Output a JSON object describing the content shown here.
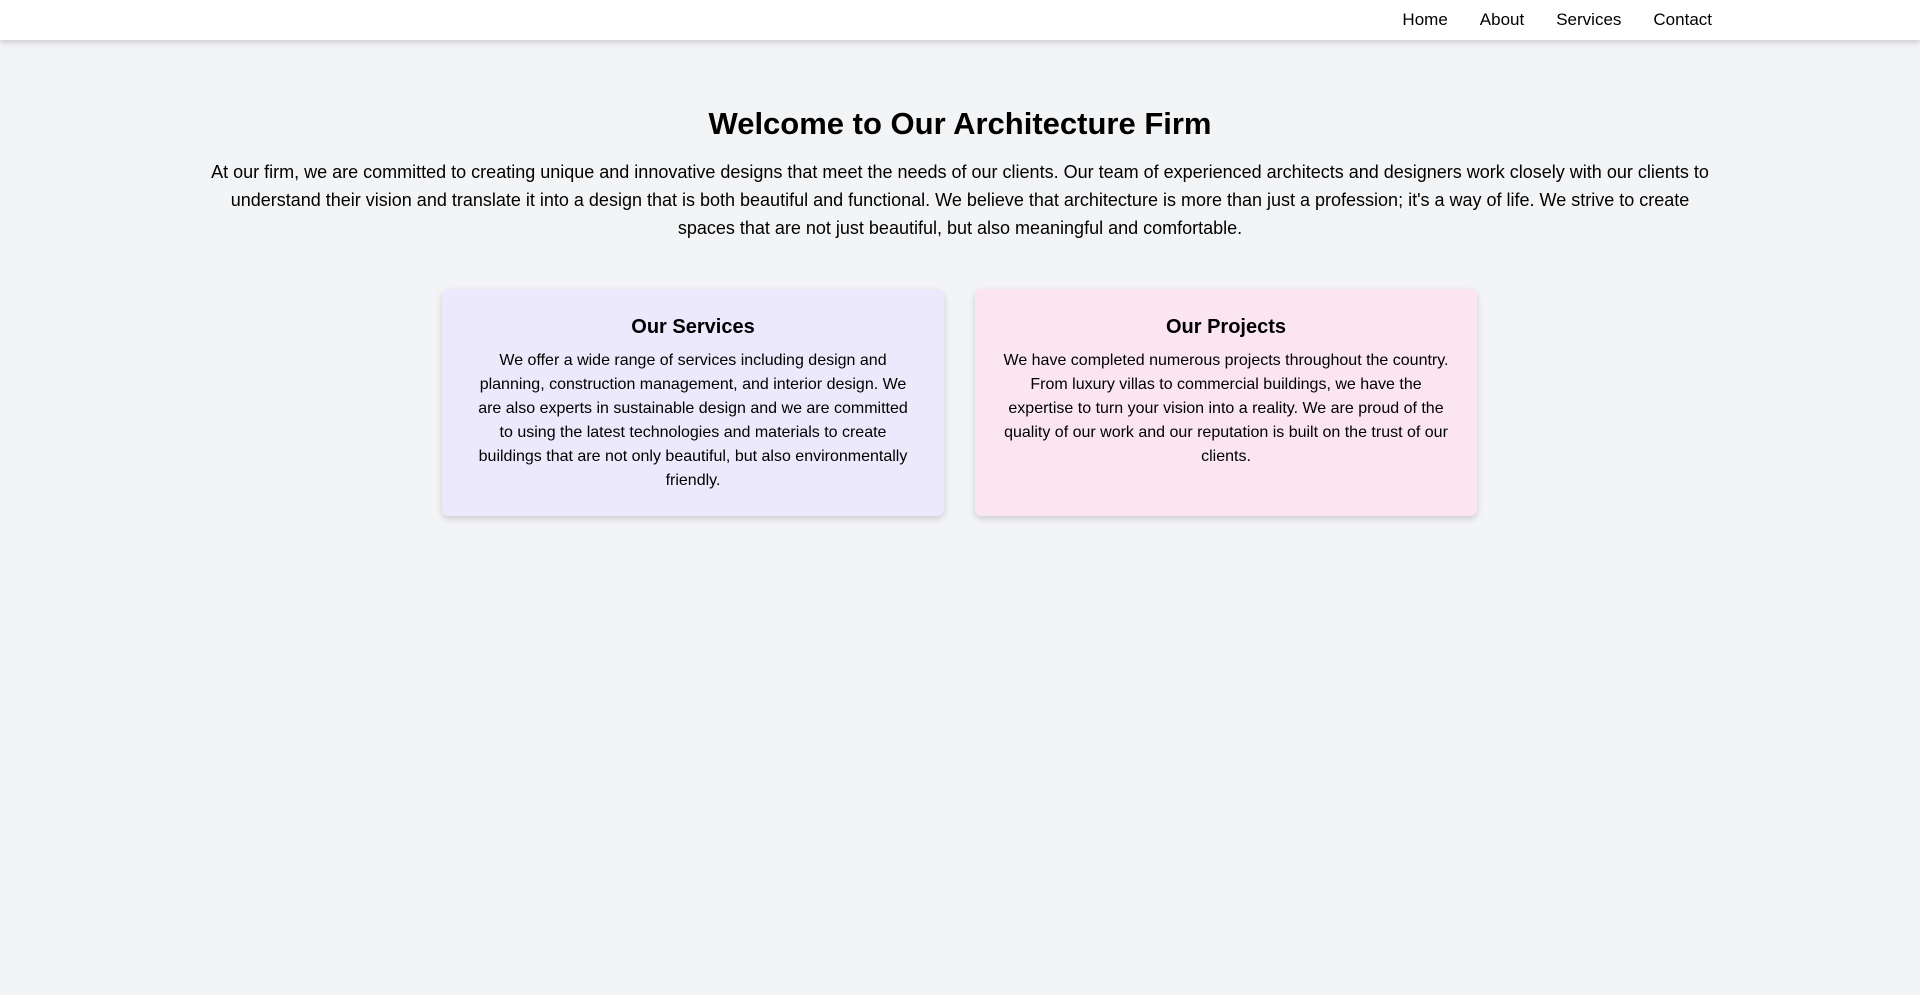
{
  "nav": {
    "links": [
      "Home",
      "About",
      "Services",
      "Contact"
    ]
  },
  "hero": {
    "title": "Welcome to Our Architecture Firm",
    "text": "At our firm, we are committed to creating unique and innovative designs that meet the needs of our clients. Our team of experienced architects and designers work closely with our clients to understand their vision and translate it into a design that is both beautiful and functional. We believe that architecture is more than just a profession; it's a way of life. We strive to create spaces that are not just beautiful, but also meaningful and comfortable."
  },
  "cards": [
    {
      "title": "Our Services",
      "text": "We offer a wide range of services including design and planning, construction management, and interior design. We are also experts in sustainable design and we are committed to using the latest technologies and materials to create buildings that are not only beautiful, but also environmentally friendly."
    },
    {
      "title": "Our Projects",
      "text": "We have completed numerous projects throughout the country. From luxury villas to commercial buildings, we have the expertise to turn your vision into a reality. We are proud of the quality of our work and our reputation is built on the trust of our clients."
    }
  ],
  "colors": {
    "page_background": "#f3f4f6",
    "services_card": "#ebe9fb",
    "projects_card": "#fbe5f1"
  }
}
